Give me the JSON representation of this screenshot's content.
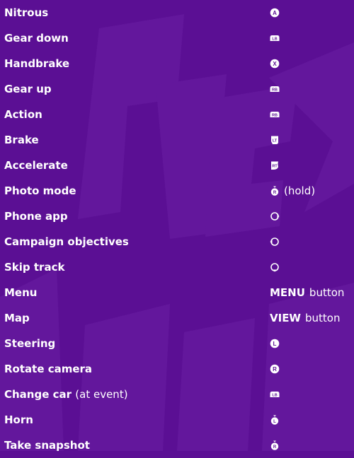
{
  "rows": [
    {
      "action": "Nitrous",
      "action_suffix": "",
      "icon": "a-button-icon",
      "glyph": "A",
      "control_word": "",
      "control_rest": ""
    },
    {
      "action": "Gear down",
      "action_suffix": "",
      "icon": "lb-button-icon",
      "glyph": "LB",
      "control_word": "",
      "control_rest": ""
    },
    {
      "action": "Handbrake",
      "action_suffix": "",
      "icon": "x-button-icon",
      "glyph": "X",
      "control_word": "",
      "control_rest": ""
    },
    {
      "action": "Gear up",
      "action_suffix": "",
      "icon": "rb-button-icon",
      "glyph": "RB",
      "control_word": "",
      "control_rest": ""
    },
    {
      "action": "Action",
      "action_suffix": "",
      "icon": "rb-button-icon",
      "glyph": "RB",
      "control_word": "",
      "control_rest": ""
    },
    {
      "action": "Brake",
      "action_suffix": "",
      "icon": "lt-trigger-icon",
      "glyph": "LT",
      "control_word": "",
      "control_rest": ""
    },
    {
      "action": "Accelerate",
      "action_suffix": "",
      "icon": "rt-trigger-icon",
      "glyph": "RT",
      "control_word": "",
      "control_rest": ""
    },
    {
      "action": "Photo mode",
      "action_suffix": "",
      "icon": "right-stick-press-icon",
      "glyph": "R",
      "control_word": "",
      "control_rest": "(hold)"
    },
    {
      "action": "Phone app",
      "action_suffix": "",
      "icon": "dpad-right-icon",
      "glyph": "",
      "control_word": "",
      "control_rest": ""
    },
    {
      "action": "Campaign objectives",
      "action_suffix": "",
      "icon": "dpad-left-icon",
      "glyph": "",
      "control_word": "",
      "control_rest": ""
    },
    {
      "action": "Skip track",
      "action_suffix": "",
      "icon": "dpad-down-icon",
      "glyph": "",
      "control_word": "",
      "control_rest": ""
    },
    {
      "action": "Menu",
      "action_suffix": "",
      "icon": "",
      "glyph": "",
      "control_word": "MENU",
      "control_rest": "button"
    },
    {
      "action": "Map",
      "action_suffix": "",
      "icon": "",
      "glyph": "",
      "control_word": "VIEW",
      "control_rest": "button"
    },
    {
      "action": "Steering",
      "action_suffix": "",
      "icon": "left-stick-icon",
      "glyph": "L",
      "control_word": "",
      "control_rest": ""
    },
    {
      "action": "Rotate camera",
      "action_suffix": "",
      "icon": "right-stick-icon",
      "glyph": "R",
      "control_word": "",
      "control_rest": ""
    },
    {
      "action": "Change car",
      "action_suffix": "(at event)",
      "icon": "lb-button-icon",
      "glyph": "LB",
      "control_word": "",
      "control_rest": ""
    },
    {
      "action": "Horn",
      "action_suffix": "",
      "icon": "left-stick-press-icon",
      "glyph": "L",
      "control_word": "",
      "control_rest": ""
    },
    {
      "action": "Take snapshot",
      "action_suffix": "",
      "icon": "right-stick-press-icon",
      "glyph": "R",
      "control_word": "",
      "control_rest": ""
    }
  ],
  "colors": {
    "background": "#5b0f94",
    "text": "#ffffff",
    "icon_fill": "#ffffff",
    "icon_glyph": "#5b0f94"
  }
}
